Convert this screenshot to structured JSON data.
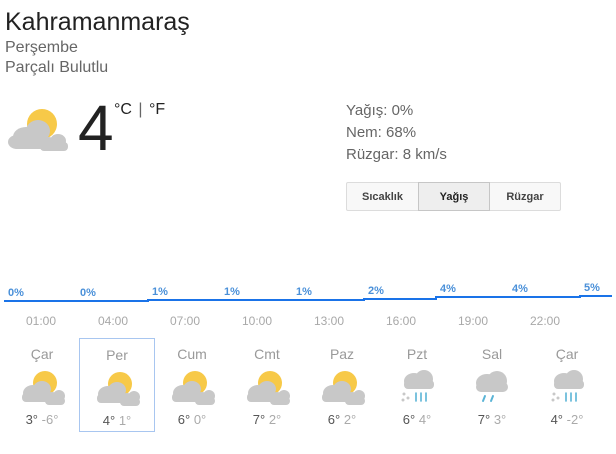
{
  "location": {
    "city": "Kahramanmaraş",
    "day": "Perşembe",
    "condition": "Parçalı Bulutlu"
  },
  "current": {
    "temperature": "4",
    "unit_c": "°C",
    "unit_sep": "|",
    "unit_f": "°F",
    "icon": "partly-cloudy-icon",
    "precipitation": "Yağış: 0%",
    "humidity": "Nem: 68%",
    "wind": "Rüzgar: 8 km/s"
  },
  "tabs": [
    {
      "label": "Sıcaklık",
      "selected": false
    },
    {
      "label": "Yağış",
      "selected": true
    },
    {
      "label": "Rüzgar",
      "selected": false
    }
  ],
  "colors": {
    "precip_line": "#1a73e8",
    "precip_label": "#4a90d9",
    "sun": "#f7c948",
    "cloud": "#c8c8c8",
    "rain": "#5ab4d6"
  },
  "precip_chart": {
    "labels": [
      "0%",
      "0%",
      "1%",
      "1%",
      "1%",
      "2%",
      "4%",
      "4%",
      "5%"
    ],
    "values": [
      0,
      0,
      1,
      1,
      1,
      2,
      4,
      4,
      5
    ]
  },
  "times": [
    "01:00",
    "04:00",
    "07:00",
    "10:00",
    "13:00",
    "16:00",
    "19:00",
    "22:00"
  ],
  "forecast": [
    {
      "day": "Çar",
      "hi": "3°",
      "lo": "-6°",
      "icon": "partly-cloudy-icon",
      "selected": false
    },
    {
      "day": "Per",
      "hi": "4°",
      "lo": "1°",
      "icon": "partly-cloudy-icon",
      "selected": true
    },
    {
      "day": "Cum",
      "hi": "6°",
      "lo": "0°",
      "icon": "partly-cloudy-icon",
      "selected": false
    },
    {
      "day": "Cmt",
      "hi": "7°",
      "lo": "2°",
      "icon": "partly-cloudy-icon",
      "selected": false
    },
    {
      "day": "Paz",
      "hi": "6°",
      "lo": "2°",
      "icon": "partly-cloudy-icon",
      "selected": false
    },
    {
      "day": "Pzt",
      "hi": "6°",
      "lo": "4°",
      "icon": "snow-rain-icon",
      "selected": false
    },
    {
      "day": "Sal",
      "hi": "7°",
      "lo": "3°",
      "icon": "rain-icon",
      "selected": false
    },
    {
      "day": "Çar",
      "hi": "4°",
      "lo": "-2°",
      "icon": "snow-rain-icon",
      "selected": false
    }
  ]
}
